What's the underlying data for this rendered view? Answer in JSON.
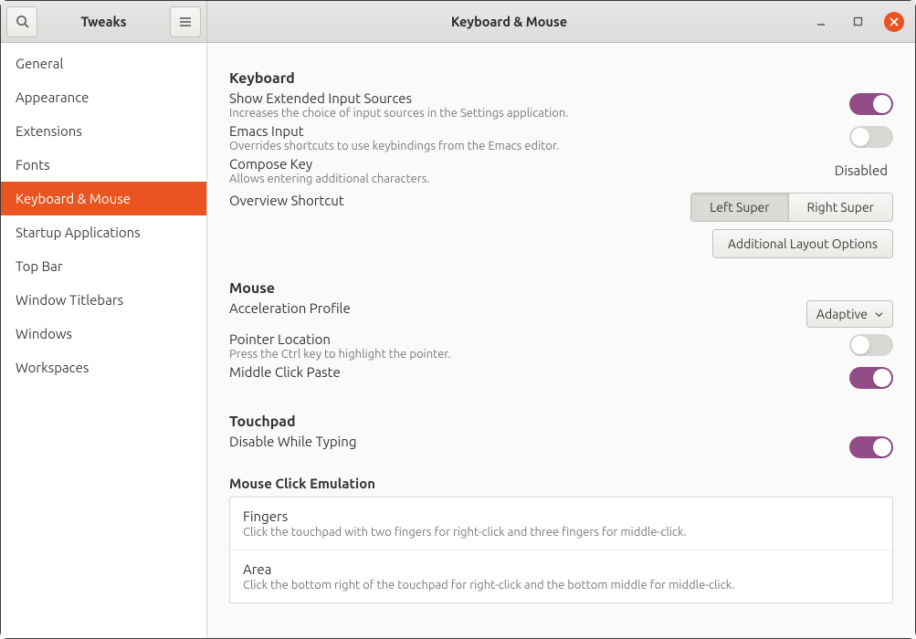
{
  "app_title": "Tweaks",
  "page_title": "Keyboard & Mouse",
  "sidebar": {
    "items": [
      {
        "label": "General"
      },
      {
        "label": "Appearance"
      },
      {
        "label": "Extensions"
      },
      {
        "label": "Fonts"
      },
      {
        "label": "Keyboard & Mouse"
      },
      {
        "label": "Startup Applications"
      },
      {
        "label": "Top Bar"
      },
      {
        "label": "Window Titlebars"
      },
      {
        "label": "Windows"
      },
      {
        "label": "Workspaces"
      }
    ],
    "active_index": 4
  },
  "keyboard": {
    "section": "Keyboard",
    "extended_sources": {
      "title": "Show Extended Input Sources",
      "desc": "Increases the choice of input sources in the Settings application.",
      "on": true
    },
    "emacs": {
      "title": "Emacs Input",
      "desc": "Overrides shortcuts to use keybindings from the Emacs editor.",
      "on": false
    },
    "compose": {
      "title": "Compose Key",
      "desc": "Allows entering additional characters.",
      "value": "Disabled"
    },
    "overview": {
      "title": "Overview Shortcut",
      "left": "Left Super",
      "right": "Right Super",
      "additional": "Additional Layout Options"
    }
  },
  "mouse": {
    "section": "Mouse",
    "accel": {
      "title": "Acceleration Profile",
      "value": "Adaptive"
    },
    "pointer": {
      "title": "Pointer Location",
      "desc": "Press the Ctrl key to highlight the pointer.",
      "on": false
    },
    "middle": {
      "title": "Middle Click Paste",
      "on": true
    }
  },
  "touchpad": {
    "section": "Touchpad",
    "disable_typing": {
      "title": "Disable While Typing",
      "on": true
    },
    "emulation": {
      "title": "Mouse Click Emulation",
      "fingers": {
        "title": "Fingers",
        "desc": "Click the touchpad with two fingers for right-click and three fingers for middle-click."
      },
      "area": {
        "title": "Area",
        "desc": "Click the bottom right of the touchpad for right-click and the bottom middle for middle-click."
      }
    }
  }
}
